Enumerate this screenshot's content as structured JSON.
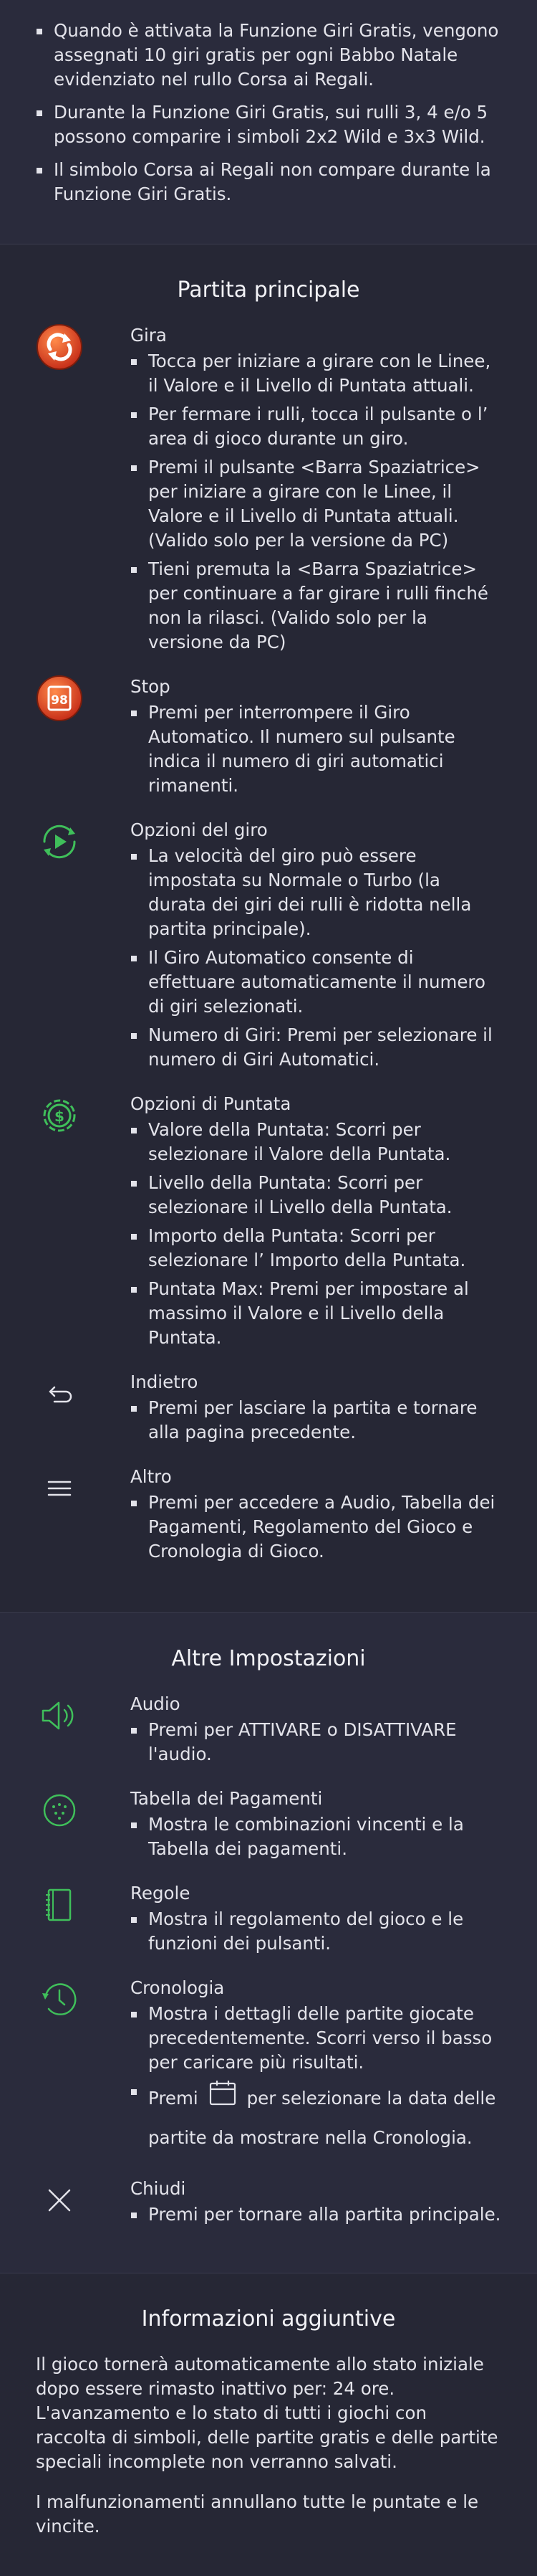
{
  "free_spins": {
    "bullets": [
      "Quando è attivata la Funzione Giri Gratis, vengono assegnati 10 giri gratis per ogni Babbo Natale evidenziato nel rullo Corsa ai Regali.",
      "Durante la Funzione Giri Gratis, sui rulli 3, 4 e/o 5 possono comparire i simboli 2x2 Wild e 3x3 Wild.",
      "Il simbolo Corsa ai Regali non compare durante la Funzione Giri Gratis."
    ]
  },
  "main_game": {
    "title": "Partita principale",
    "items": [
      {
        "icon": "spin-icon",
        "title": "Gira",
        "bullets": [
          "Tocca per iniziare a girare con le Linee, il Valore e il Livello di Puntata attuali.",
          "Per fermare i rulli, tocca il pulsante o l’ area di gioco durante un giro.",
          "Premi il pulsante <Barra Spaziatrice> per iniziare a girare con le Linee, il Valore e il Livello di Puntata attuali. (Valido solo per la versione da PC)",
          "Tieni premuta la <Barra Spaziatrice> per continuare a far girare i rulli finché non la rilasci. (Valido solo per la versione da PC)"
        ]
      },
      {
        "icon": "stop-icon",
        "badge": "98",
        "title": "Stop",
        "bullets": [
          "Premi per interrompere il Giro Automatico. Il numero sul pulsante indica il numero di giri automatici rimanenti."
        ]
      },
      {
        "icon": "spin-options-icon",
        "title": "Opzioni del giro",
        "bullets": [
          "La velocità del giro può essere impostata su Normale o Turbo (la durata dei giri dei rulli è ridotta nella partita principale).",
          "Il Giro Automatico consente di effettuare automaticamente il numero di giri selezionati.",
          "Numero di Giri: Premi per selezionare il numero di Giri Automatici."
        ]
      },
      {
        "icon": "bet-options-icon",
        "title": "Opzioni di Puntata",
        "bullets": [
          "Valore della Puntata: Scorri per selezionare il Valore della Puntata.",
          "Livello della Puntata: Scorri per selezionare il Livello della Puntata.",
          "Importo della Puntata: Scorri per selezionare l’ Importo della Puntata.",
          "Puntata Max: Premi per impostare al massimo il Valore e il Livello della Puntata."
        ]
      },
      {
        "icon": "back-icon",
        "title": "Indietro",
        "bullets": [
          "Premi per lasciare la partita e tornare alla pagina precedente."
        ]
      },
      {
        "icon": "menu-icon",
        "title": "Altro",
        "bullets": [
          "Premi per accedere a Audio, Tabella dei Pagamenti, Regolamento del Gioco e Cronologia di Gioco."
        ]
      }
    ]
  },
  "other_settings": {
    "title": "Altre Impostazioni",
    "items": [
      {
        "icon": "speaker-icon",
        "title": "Audio",
        "bullets": [
          "Premi per ATTIVARE o DISATTIVARE l'audio."
        ]
      },
      {
        "icon": "paytable-icon",
        "title": "Tabella dei Pagamenti",
        "bullets": [
          "Mostra le combinazioni vincenti e la Tabella dei pagamenti."
        ]
      },
      {
        "icon": "rules-book-icon",
        "title": "Regole",
        "bullets": [
          "Mostra il regolamento del gioco e le funzioni dei pulsanti."
        ]
      },
      {
        "icon": "history-clock-icon",
        "title": "Cronologia",
        "bullets": [
          "Mostra i dettagli delle partite giocate precedentemente. Scorri verso il basso per caricare più risultati."
        ],
        "calendar_before": "Premi",
        "calendar_after": "per selezionare la data delle",
        "calendar_rest": "partite da mostrare nella Cronologia."
      },
      {
        "icon": "close-icon",
        "title": "Chiudi",
        "bullets": [
          "Premi per tornare alla partita principale."
        ]
      }
    ]
  },
  "additional_info": {
    "title": "Informazioni aggiuntive",
    "paragraphs": [
      "Il gioco tornerà automaticamente allo stato iniziale dopo essere rimasto inattivo per: 24 ore. L'avanzamento e lo stato di tutti i giochi con raccolta di simboli, delle partite gratis e delle partite speciali incomplete non verranno salvati.",
      "I malfunzionamenti annullano tutte le puntate e le vincite."
    ]
  },
  "colors": {
    "background": "#2a2b3c",
    "text": "#e3e3ea",
    "accent_green": "#3fbf5a",
    "accent_orange": "#e8562a"
  }
}
